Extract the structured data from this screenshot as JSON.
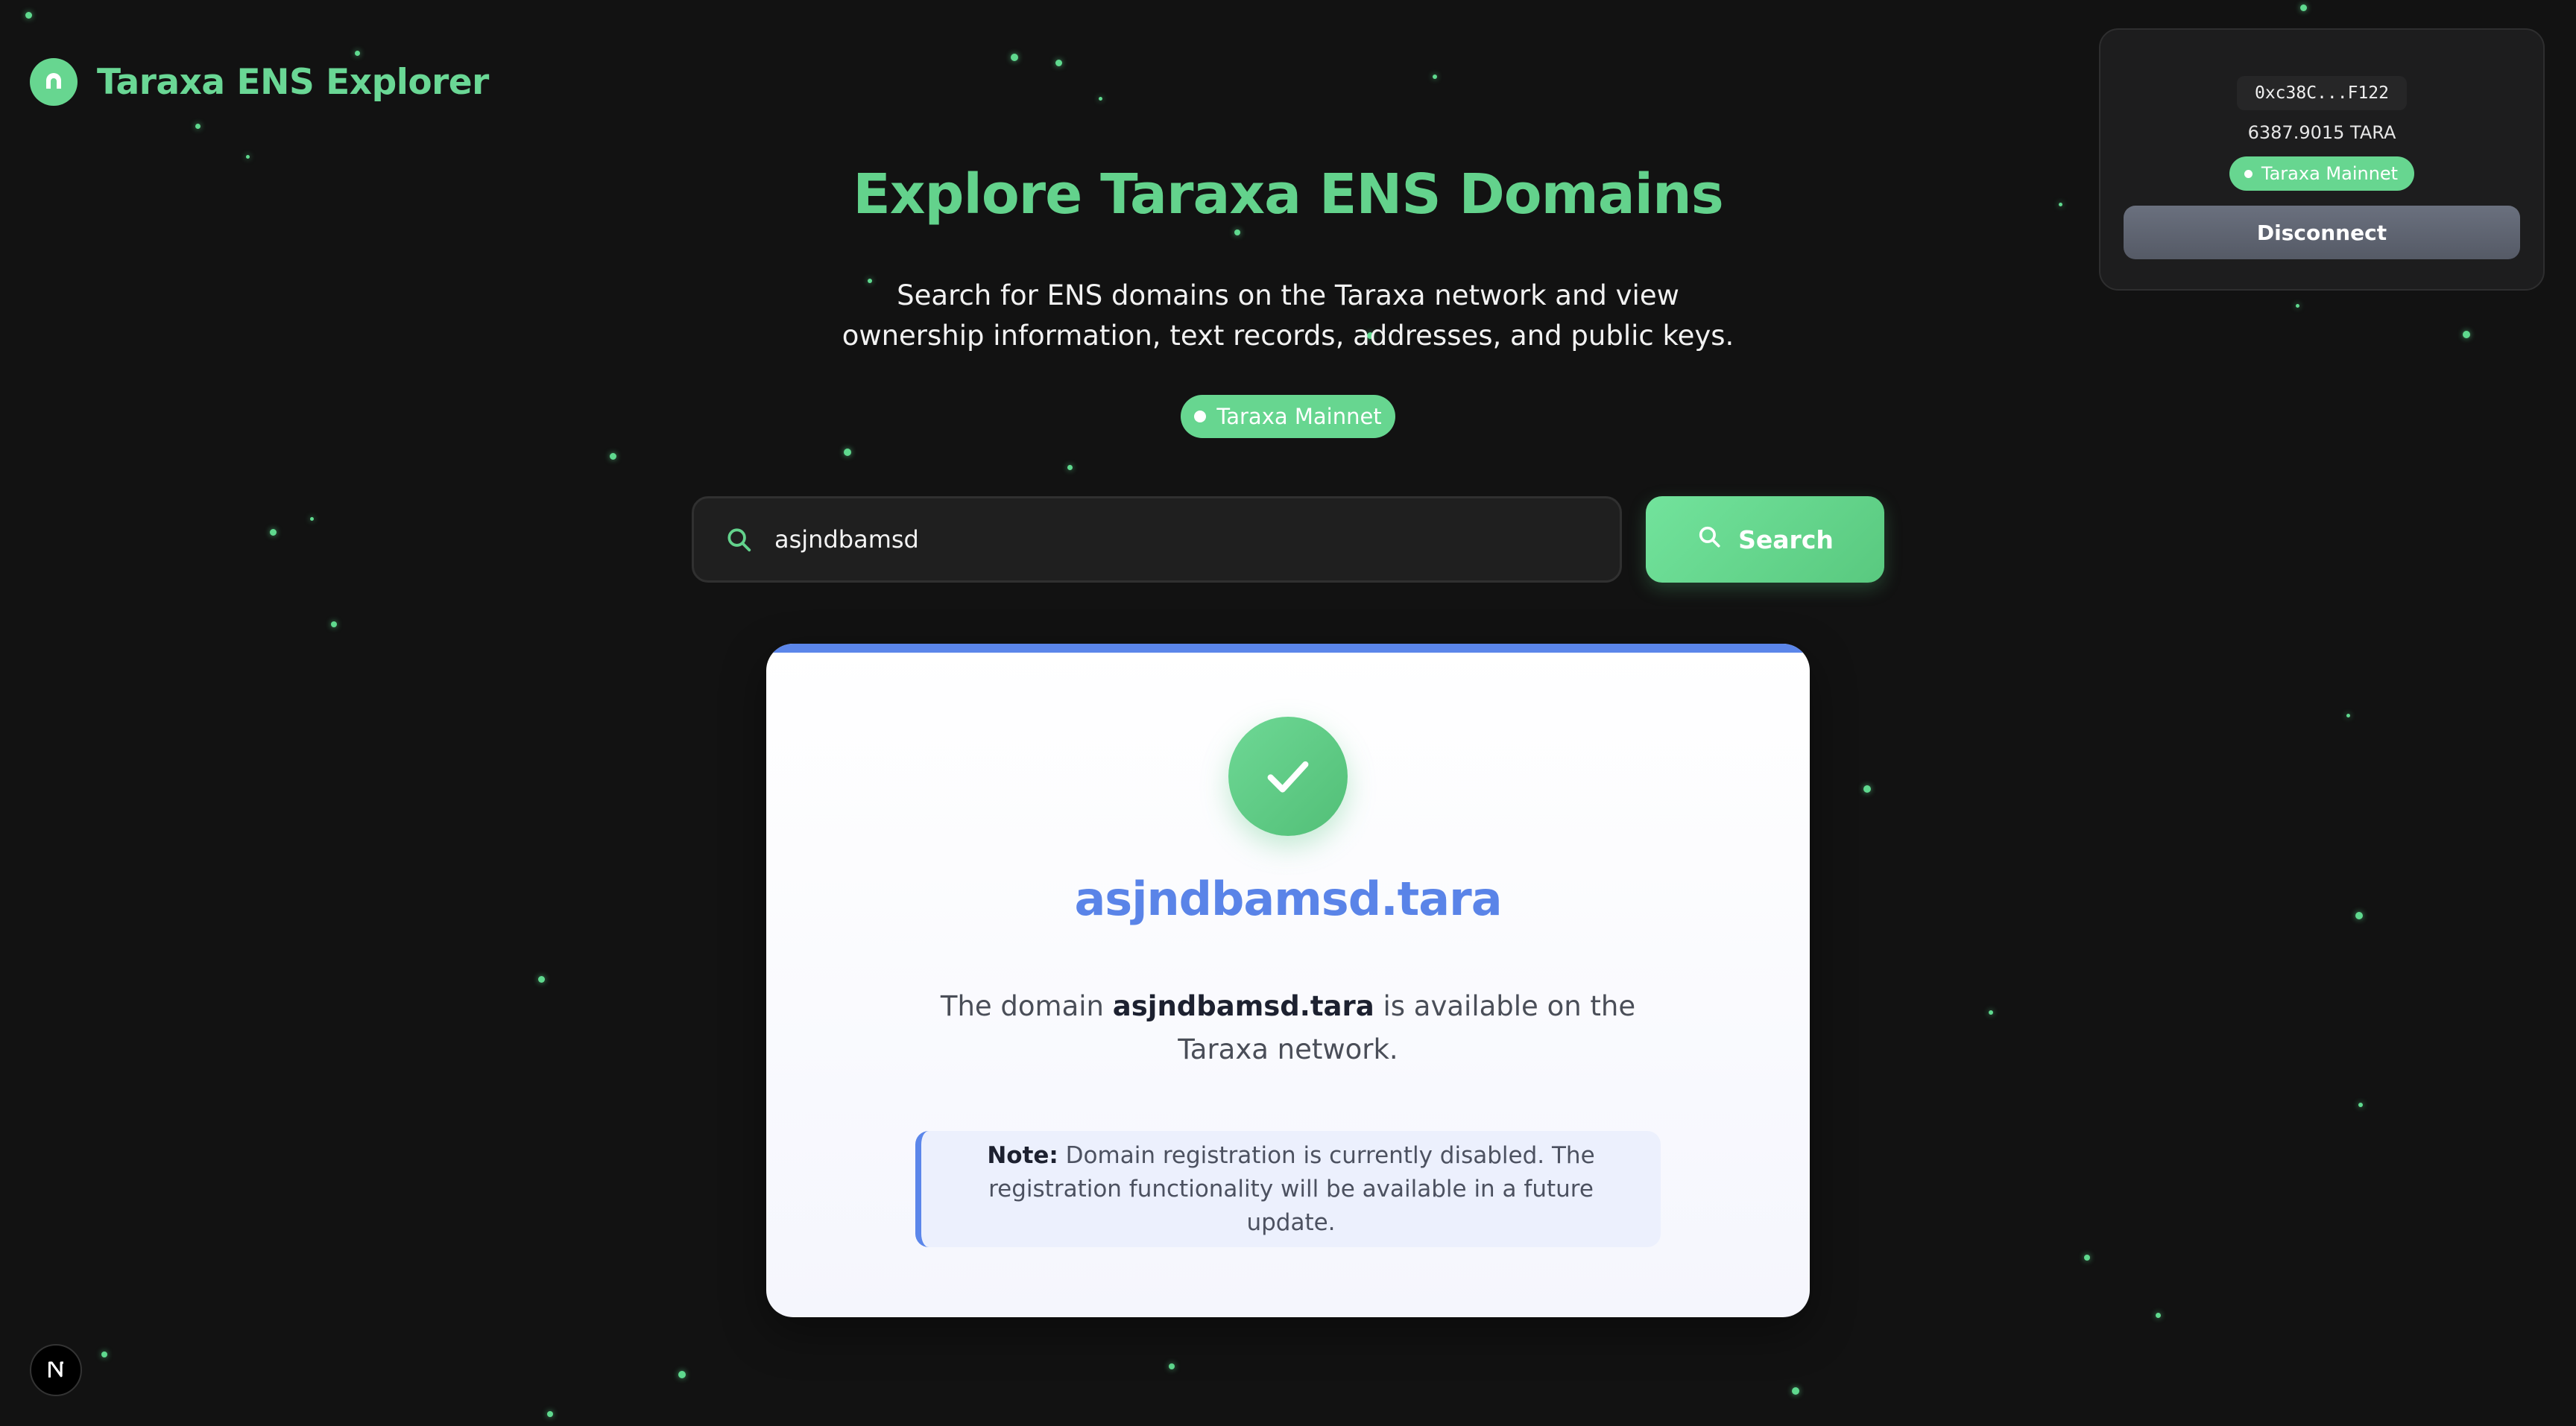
{
  "app": {
    "title": "Taraxa ENS Explorer"
  },
  "wallet": {
    "address": "0xc38C...F122",
    "balance": "6387.9015 TARA",
    "network": "Taraxa Mainnet",
    "disconnect_label": "Disconnect"
  },
  "hero": {
    "title": "Explore Taraxa ENS Domains",
    "subtitle": "Search for ENS domains on the Taraxa network and view ownership information, text records, addresses, and public keys.",
    "network_badge": "Taraxa Mainnet"
  },
  "search": {
    "value": "asjndbamsd",
    "button_label": "Search"
  },
  "result": {
    "domain": "asjndbamsd.tara",
    "message_prefix": "The domain ",
    "message_domain": "asjndbamsd.tara",
    "message_suffix": " is available on the Taraxa network.",
    "note_label": "Note:",
    "note_text": " Domain registration is currently disabled. The registration functionality will be available in a future update."
  },
  "colors": {
    "accent_green": "#67d690",
    "accent_blue": "#5b86ea",
    "background": "#121212"
  },
  "icons": {
    "logo": "taraxa-logo-icon",
    "search": "search-icon",
    "success": "check-icon",
    "framework": "nextjs-icon"
  }
}
